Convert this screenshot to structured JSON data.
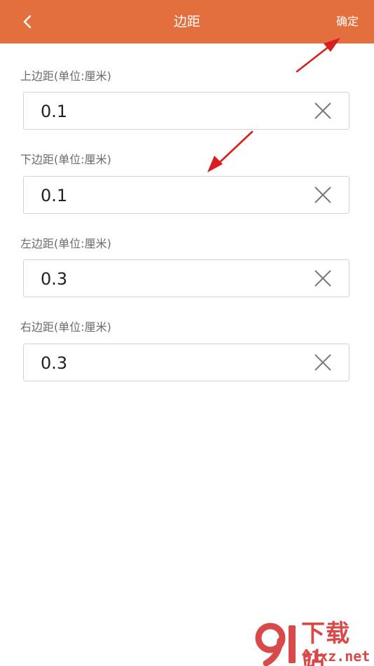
{
  "header": {
    "title": "边距",
    "confirm_label": "确定",
    "back_icon": "chevron-left-icon",
    "background": "#e36e3e"
  },
  "fields": [
    {
      "label": "上边距(单位:厘米)",
      "value": "0.1"
    },
    {
      "label": "下边距(单位:厘米)",
      "value": "0.1"
    },
    {
      "label": "左边距(单位:厘米)",
      "value": "0.3"
    },
    {
      "label": "右边距(单位:厘米)",
      "value": "0.3"
    }
  ],
  "clear_icon": "close-icon",
  "annotation_color": "#d81e1e",
  "watermark": {
    "title": "下载站",
    "domain": "91xz.net",
    "color": "#d84a49"
  }
}
